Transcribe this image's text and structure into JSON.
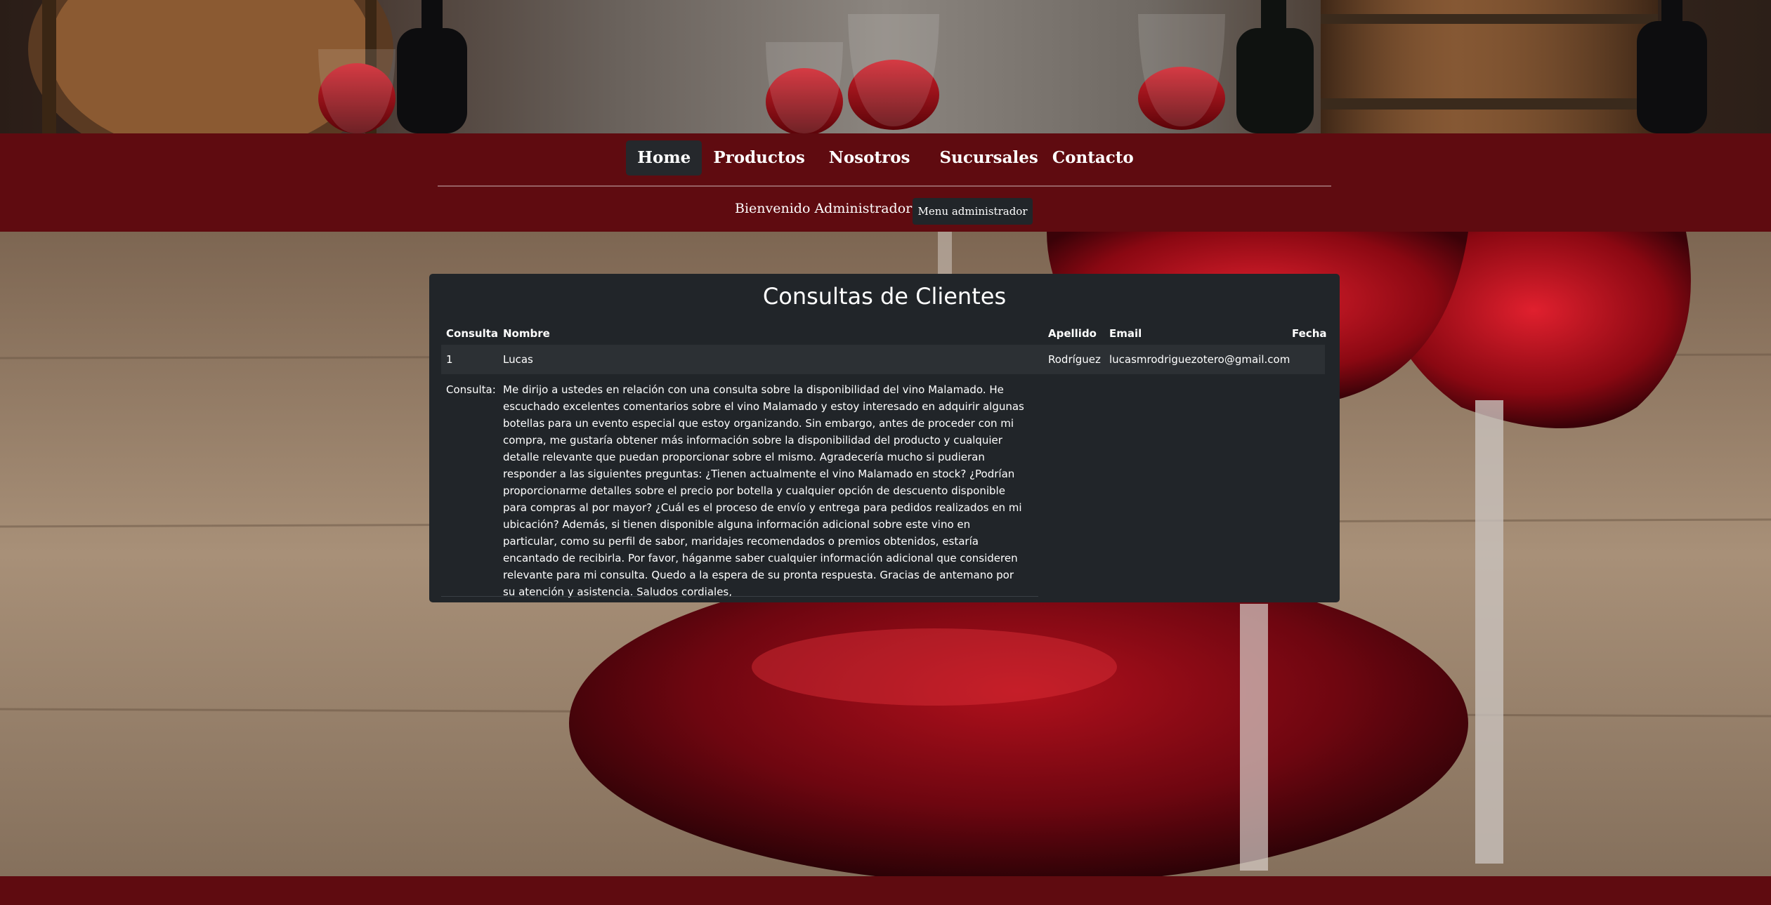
{
  "nav": {
    "items": [
      {
        "label": "Home",
        "active": true
      },
      {
        "label": "Productos",
        "active": false
      },
      {
        "label": "Nosotros",
        "active": false
      },
      {
        "label": "Sucursales",
        "active": false
      },
      {
        "label": "Contacto",
        "active": false
      }
    ],
    "welcome": "Bienvenido Administrador",
    "admin_menu": "Menu administrador"
  },
  "card": {
    "title": "Consultas de Clientes",
    "headers": {
      "consulta": "Consulta",
      "nombre": "Nombre",
      "apellido": "Apellido",
      "email": "Email",
      "fecha": "Fecha"
    },
    "rows": [
      {
        "consulta": "1",
        "nombre": "Lucas",
        "apellido": "Rodríguez",
        "email": "lucasmrodriguezotero@gmail.com",
        "fecha": "",
        "detail_label": "Consulta:",
        "detail_text": "Me dirijo a ustedes en relación con una consulta sobre la disponibilidad del vino Malamado. He escuchado excelentes comentarios sobre el vino Malamado y estoy interesado en adquirir algunas botellas para un evento especial que estoy organizando. Sin embargo, antes de proceder con mi compra, me gustaría obtener más información sobre la disponibilidad del producto y cualquier detalle relevante que puedan proporcionar sobre el mismo. Agradecería mucho si pudieran responder a las siguientes preguntas: ¿Tienen actualmente el vino Malamado en stock? ¿Podrían proporcionarme detalles sobre el precio por botella y cualquier opción de descuento disponible para compras al por mayor? ¿Cuál es el proceso de envío y entrega para pedidos realizados en mi ubicación? Además, si tienen disponible alguna información adicional sobre este vino en particular, como su perfil de sabor, maridajes recomendados o premios obtenidos, estaría encantado de recibirla. Por favor, háganme saber cualquier información adicional que consideren relevante para mi consulta. Quedo a la espera de su pronta respuesta. Gracias de antemano por su atención y asistencia. Saludos cordiales,"
      }
    ]
  },
  "colors": {
    "nav_bg": "#5f0b10",
    "card_bg": "#212529",
    "active_tab": "#25282c"
  }
}
